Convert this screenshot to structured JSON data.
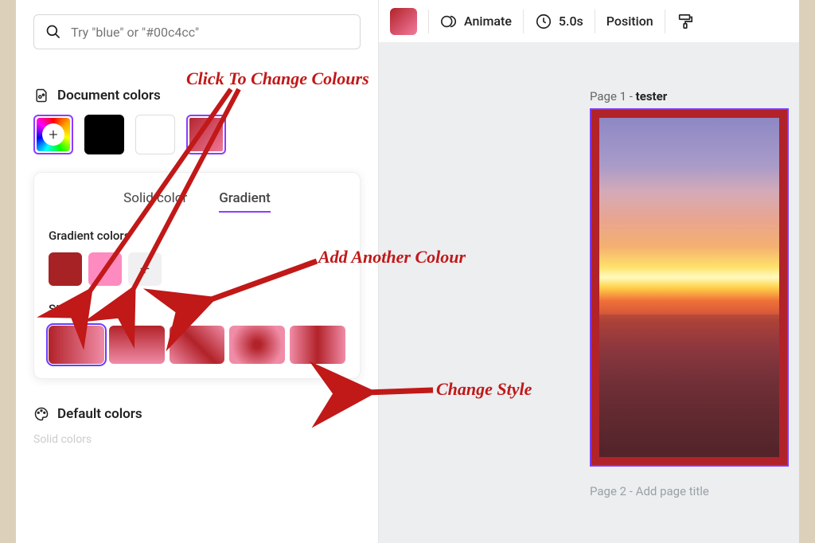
{
  "search": {
    "placeholder": "Try \"blue\" or \"#00c4cc\""
  },
  "section_doc_colors": "Document colors",
  "tabs": {
    "solid": "Solid color",
    "gradient": "Gradient"
  },
  "grad_section": "Gradient colors",
  "style_section": "Style",
  "section_default_colors": "Default colors",
  "solid_sub": "Solid colors",
  "toolbar": {
    "animate": "Animate",
    "duration": "5.0s",
    "position": "Position"
  },
  "page1_prefix": "Page 1 - ",
  "page1_name": "tester",
  "page2_prefix": "Page 2 - ",
  "page2_placeholder": "Add page title",
  "annotations": {
    "change_colours": "Click To Change Colours",
    "add_colour": "Add Another Colour",
    "change_style": "Change Style"
  },
  "colors": {
    "grad_a": "#a62225",
    "grad_b": "#fd8bc0"
  }
}
